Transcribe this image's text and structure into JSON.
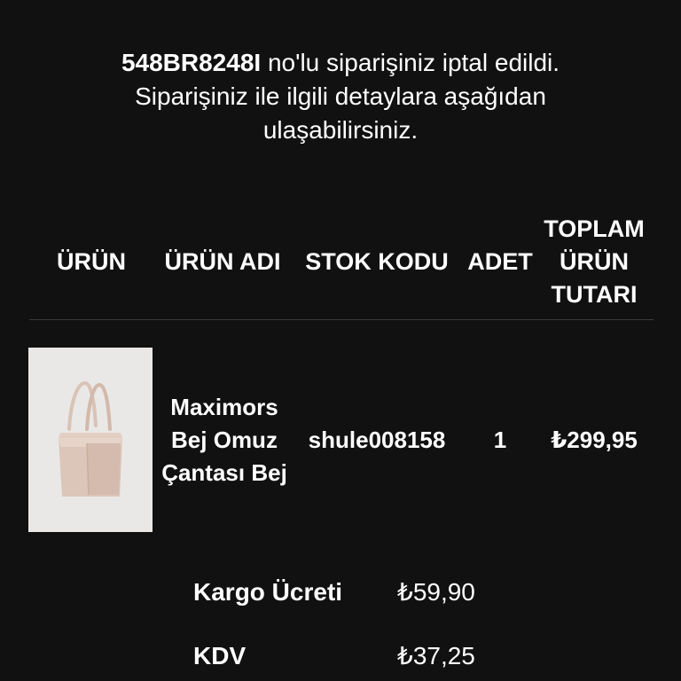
{
  "notice": {
    "order_number": "548BR8248I",
    "line1_rest": " no'lu siparişiniz iptal edildi.",
    "line2": "Siparişiniz ile ilgili detaylara aşağıdan",
    "line3": "ulaşabilirsiniz."
  },
  "table": {
    "headers": {
      "product": "ÜRÜN",
      "product_name": "ÜRÜN ADI",
      "stock_code": "STOK KODU",
      "quantity": "ADET",
      "total_line1": "TOPLAM",
      "total_line2": "ÜRÜN",
      "total_line3": "TUTARI"
    },
    "rows": [
      {
        "image_desc": "beige-tote-bag-photo",
        "name_line1": "Maximors",
        "name_line2": "Bej Omuz",
        "name_line3": "Çantası Bej",
        "stock_code": "shule008158",
        "quantity": "1",
        "total": "₺299,95"
      }
    ]
  },
  "summary": {
    "shipping_label": "Kargo Ücreti",
    "shipping_value": "₺59,90",
    "tax_label": "KDV",
    "tax_value": "₺37,25"
  }
}
